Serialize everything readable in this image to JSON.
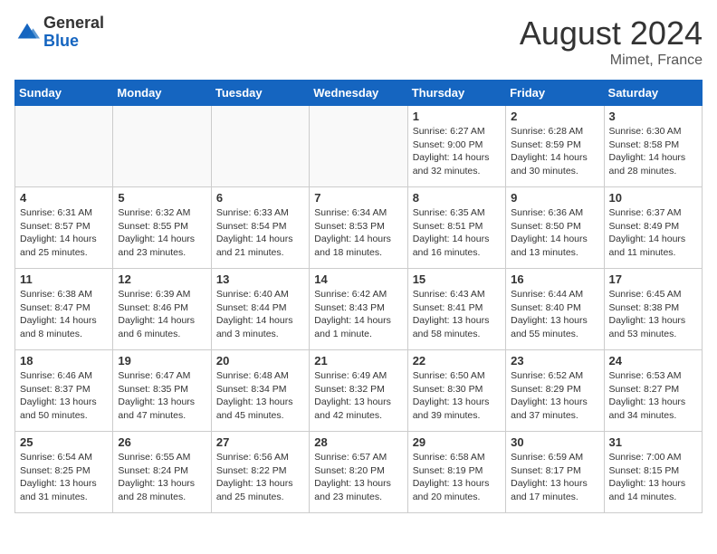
{
  "header": {
    "logo_general": "General",
    "logo_blue": "Blue",
    "month_title": "August 2024",
    "location": "Mimet, France"
  },
  "days_of_week": [
    "Sunday",
    "Monday",
    "Tuesday",
    "Wednesday",
    "Thursday",
    "Friday",
    "Saturday"
  ],
  "weeks": [
    [
      {
        "day": "",
        "info": ""
      },
      {
        "day": "",
        "info": ""
      },
      {
        "day": "",
        "info": ""
      },
      {
        "day": "",
        "info": ""
      },
      {
        "day": "1",
        "info": "Sunrise: 6:27 AM\nSunset: 9:00 PM\nDaylight: 14 hours\nand 32 minutes."
      },
      {
        "day": "2",
        "info": "Sunrise: 6:28 AM\nSunset: 8:59 PM\nDaylight: 14 hours\nand 30 minutes."
      },
      {
        "day": "3",
        "info": "Sunrise: 6:30 AM\nSunset: 8:58 PM\nDaylight: 14 hours\nand 28 minutes."
      }
    ],
    [
      {
        "day": "4",
        "info": "Sunrise: 6:31 AM\nSunset: 8:57 PM\nDaylight: 14 hours\nand 25 minutes."
      },
      {
        "day": "5",
        "info": "Sunrise: 6:32 AM\nSunset: 8:55 PM\nDaylight: 14 hours\nand 23 minutes."
      },
      {
        "day": "6",
        "info": "Sunrise: 6:33 AM\nSunset: 8:54 PM\nDaylight: 14 hours\nand 21 minutes."
      },
      {
        "day": "7",
        "info": "Sunrise: 6:34 AM\nSunset: 8:53 PM\nDaylight: 14 hours\nand 18 minutes."
      },
      {
        "day": "8",
        "info": "Sunrise: 6:35 AM\nSunset: 8:51 PM\nDaylight: 14 hours\nand 16 minutes."
      },
      {
        "day": "9",
        "info": "Sunrise: 6:36 AM\nSunset: 8:50 PM\nDaylight: 14 hours\nand 13 minutes."
      },
      {
        "day": "10",
        "info": "Sunrise: 6:37 AM\nSunset: 8:49 PM\nDaylight: 14 hours\nand 11 minutes."
      }
    ],
    [
      {
        "day": "11",
        "info": "Sunrise: 6:38 AM\nSunset: 8:47 PM\nDaylight: 14 hours\nand 8 minutes."
      },
      {
        "day": "12",
        "info": "Sunrise: 6:39 AM\nSunset: 8:46 PM\nDaylight: 14 hours\nand 6 minutes."
      },
      {
        "day": "13",
        "info": "Sunrise: 6:40 AM\nSunset: 8:44 PM\nDaylight: 14 hours\nand 3 minutes."
      },
      {
        "day": "14",
        "info": "Sunrise: 6:42 AM\nSunset: 8:43 PM\nDaylight: 14 hours\nand 1 minute."
      },
      {
        "day": "15",
        "info": "Sunrise: 6:43 AM\nSunset: 8:41 PM\nDaylight: 13 hours\nand 58 minutes."
      },
      {
        "day": "16",
        "info": "Sunrise: 6:44 AM\nSunset: 8:40 PM\nDaylight: 13 hours\nand 55 minutes."
      },
      {
        "day": "17",
        "info": "Sunrise: 6:45 AM\nSunset: 8:38 PM\nDaylight: 13 hours\nand 53 minutes."
      }
    ],
    [
      {
        "day": "18",
        "info": "Sunrise: 6:46 AM\nSunset: 8:37 PM\nDaylight: 13 hours\nand 50 minutes."
      },
      {
        "day": "19",
        "info": "Sunrise: 6:47 AM\nSunset: 8:35 PM\nDaylight: 13 hours\nand 47 minutes."
      },
      {
        "day": "20",
        "info": "Sunrise: 6:48 AM\nSunset: 8:34 PM\nDaylight: 13 hours\nand 45 minutes."
      },
      {
        "day": "21",
        "info": "Sunrise: 6:49 AM\nSunset: 8:32 PM\nDaylight: 13 hours\nand 42 minutes."
      },
      {
        "day": "22",
        "info": "Sunrise: 6:50 AM\nSunset: 8:30 PM\nDaylight: 13 hours\nand 39 minutes."
      },
      {
        "day": "23",
        "info": "Sunrise: 6:52 AM\nSunset: 8:29 PM\nDaylight: 13 hours\nand 37 minutes."
      },
      {
        "day": "24",
        "info": "Sunrise: 6:53 AM\nSunset: 8:27 PM\nDaylight: 13 hours\nand 34 minutes."
      }
    ],
    [
      {
        "day": "25",
        "info": "Sunrise: 6:54 AM\nSunset: 8:25 PM\nDaylight: 13 hours\nand 31 minutes."
      },
      {
        "day": "26",
        "info": "Sunrise: 6:55 AM\nSunset: 8:24 PM\nDaylight: 13 hours\nand 28 minutes."
      },
      {
        "day": "27",
        "info": "Sunrise: 6:56 AM\nSunset: 8:22 PM\nDaylight: 13 hours\nand 25 minutes."
      },
      {
        "day": "28",
        "info": "Sunrise: 6:57 AM\nSunset: 8:20 PM\nDaylight: 13 hours\nand 23 minutes."
      },
      {
        "day": "29",
        "info": "Sunrise: 6:58 AM\nSunset: 8:19 PM\nDaylight: 13 hours\nand 20 minutes."
      },
      {
        "day": "30",
        "info": "Sunrise: 6:59 AM\nSunset: 8:17 PM\nDaylight: 13 hours\nand 17 minutes."
      },
      {
        "day": "31",
        "info": "Sunrise: 7:00 AM\nSunset: 8:15 PM\nDaylight: 13 hours\nand 14 minutes."
      }
    ]
  ]
}
